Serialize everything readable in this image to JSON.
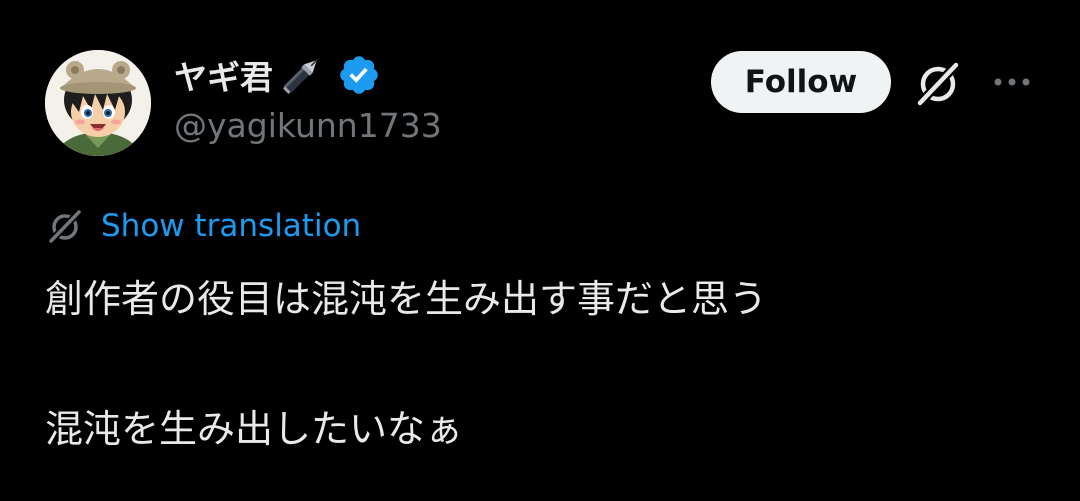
{
  "author": {
    "display_name": "ヤギ君",
    "name_emoji": "fountain-pen-icon",
    "verified": true,
    "handle": "@yagikunn1733"
  },
  "actions": {
    "follow_label": "Follow",
    "grok_icon": "grok-icon",
    "more_icon": "more-horizontal-icon"
  },
  "translation": {
    "label": "Show translation",
    "icon": "grok-translate-icon"
  },
  "tweet": {
    "lines": [
      "創作者の役目は混沌を生み出す事だと思う",
      "混沌を生み出したいなぁ"
    ]
  },
  "colors": {
    "background": "#000000",
    "text_primary": "#e7e9ea",
    "text_secondary": "#71767b",
    "accent": "#1d9bf0",
    "follow_bg": "#eff3f4",
    "follow_text": "#0f1419"
  }
}
